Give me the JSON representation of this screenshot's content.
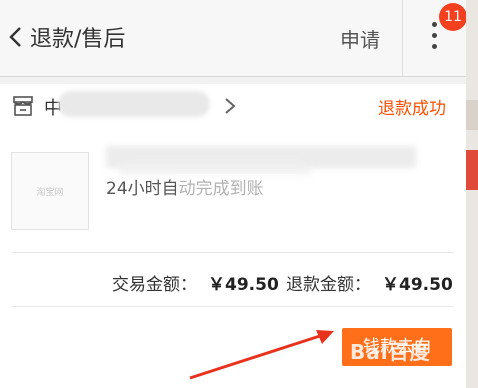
{
  "header": {
    "title": "退款/售后",
    "apply_label": "申请",
    "badge_count": "11"
  },
  "shop": {
    "name_prefix": "中",
    "status": "退款成功"
  },
  "product": {
    "thumb_logo": "淘宝网",
    "description": "24小时自动完成到账"
  },
  "amounts": {
    "trade_label": "交易金额：",
    "trade_value": "￥49.50",
    "refund_label": "退款金额：",
    "refund_value": "￥49.50"
  },
  "action": {
    "label": "钱款去向"
  },
  "watermark": {
    "text": "Bai百度"
  },
  "colors": {
    "accent": "#ff5000",
    "button": "#ff6f1a",
    "badge": "#f4401f",
    "arrow": "#e8321e"
  }
}
